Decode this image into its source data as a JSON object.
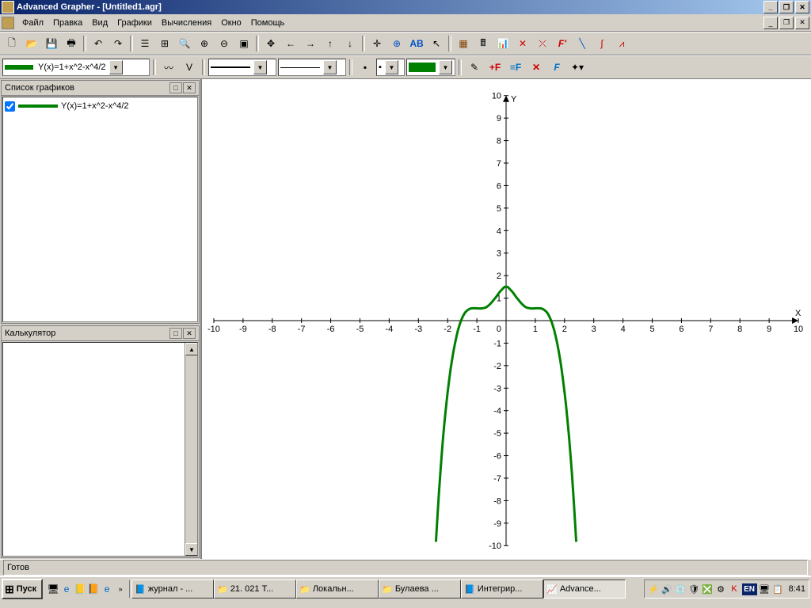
{
  "title": "Advanced Grapher - [Untitled1.agr]",
  "menu": [
    "Файл",
    "Правка",
    "Вид",
    "Графики",
    "Вычисления",
    "Окно",
    "Помощь"
  ],
  "formula": {
    "selector_text": "Y(x)=1+x^2-x^4/2",
    "swatch_color": "#008000"
  },
  "panels": {
    "graph_list": {
      "title": "Список графиков",
      "item": "Y(x)=1+x^2-x^4/2"
    },
    "calculator": {
      "title": "Калькулятор"
    }
  },
  "status": "Готов",
  "taskbar": {
    "start": "Пуск",
    "tasks": [
      {
        "icon": "📘",
        "label": "журнал - ..."
      },
      {
        "icon": "📁",
        "label": "21. 021 Т..."
      },
      {
        "icon": "📁",
        "label": "Локальн..."
      },
      {
        "icon": "📁",
        "label": "Булаева ..."
      },
      {
        "icon": "📘",
        "label": "Интегрир..."
      },
      {
        "icon": "📈",
        "label": "Advance...",
        "active": true
      }
    ],
    "lang": "EN",
    "clock": "8:41"
  },
  "chart_data": {
    "type": "line",
    "title": "",
    "xlabel": "X",
    "ylabel": "Y",
    "xlim": [
      -10,
      10
    ],
    "ylim": [
      -10,
      10
    ],
    "function": "Y = 1 + x^2 - x^4/2",
    "series": [
      {
        "name": "Y(x)=1+x^2-x^4/2",
        "color": "#008000",
        "x": [
          -2.4,
          -2.35,
          -2.3,
          -2.25,
          -2.2,
          -2.15,
          -2.1,
          -2.05,
          -2.0,
          -1.95,
          -1.9,
          -1.85,
          -1.8,
          -1.75,
          -1.7,
          -1.65,
          -1.6,
          -1.55,
          -1.5,
          -1.45,
          -1.4,
          -1.35,
          -1.3,
          -1.25,
          -1.2,
          -1.15,
          -1.1,
          -1.05,
          -1.0,
          -0.95,
          -0.9,
          -0.85,
          -0.8,
          -0.75,
          -0.7,
          -0.65,
          -0.6,
          -0.55,
          -0.5,
          -0.45,
          -0.4,
          -0.35,
          -0.3,
          -0.25,
          -0.2,
          -0.15,
          -0.1,
          -0.05,
          0.0,
          0.05,
          0.1,
          0.15,
          0.2,
          0.25,
          0.3,
          0.35,
          0.4,
          0.45,
          0.5,
          0.55,
          0.6,
          0.65,
          0.7,
          0.75,
          0.8,
          0.85,
          0.9,
          0.95,
          1.0,
          1.05,
          1.1,
          1.15,
          1.2,
          1.25,
          1.3,
          1.35,
          1.4,
          1.45,
          1.5,
          1.55,
          1.6,
          1.65,
          1.7,
          1.75,
          1.8,
          1.85,
          1.9,
          1.95,
          2.0,
          2.05,
          2.1,
          2.15,
          2.2,
          2.25,
          2.3,
          2.35,
          2.4
        ],
        "y": [
          -9.83,
          -8.72,
          -7.71,
          -6.77,
          -5.91,
          -5.13,
          -4.41,
          -3.77,
          -3.18,
          -2.65,
          -2.17,
          -1.74,
          -1.36,
          -1.02,
          -0.72,
          -0.45,
          -0.22,
          -0.03,
          0.13,
          0.26,
          0.36,
          0.43,
          0.48,
          0.52,
          0.54,
          0.55,
          0.55,
          0.55,
          0.55,
          0.54,
          0.54,
          0.54,
          0.55,
          0.56,
          0.58,
          0.62,
          0.67,
          0.73,
          0.8,
          0.88,
          0.96,
          1.04,
          1.13,
          1.22,
          1.3,
          1.37,
          1.44,
          1.5,
          1.5,
          1.5,
          1.44,
          1.37,
          1.3,
          1.22,
          1.13,
          1.04,
          0.96,
          0.88,
          0.8,
          0.73,
          0.67,
          0.62,
          0.58,
          0.56,
          0.55,
          0.54,
          0.54,
          0.54,
          0.55,
          0.55,
          0.55,
          0.55,
          0.54,
          0.52,
          0.48,
          0.43,
          0.36,
          0.26,
          0.13,
          -0.03,
          -0.22,
          -0.45,
          -0.72,
          -1.02,
          -1.36,
          -1.74,
          -2.17,
          -2.65,
          -3.18,
          -3.77,
          -4.41,
          -5.13,
          -5.91,
          -6.77,
          -7.71,
          -8.72,
          -9.83
        ]
      }
    ],
    "x_ticks": [
      -10,
      -9,
      -8,
      -7,
      -6,
      -5,
      -4,
      -3,
      -2,
      -1,
      0,
      1,
      2,
      3,
      4,
      5,
      6,
      7,
      8,
      9,
      10
    ],
    "y_ticks": [
      -10,
      -9,
      -8,
      -7,
      -6,
      -5,
      -4,
      -3,
      -2,
      -1,
      1,
      2,
      3,
      4,
      5,
      6,
      7,
      8,
      9,
      10
    ]
  }
}
